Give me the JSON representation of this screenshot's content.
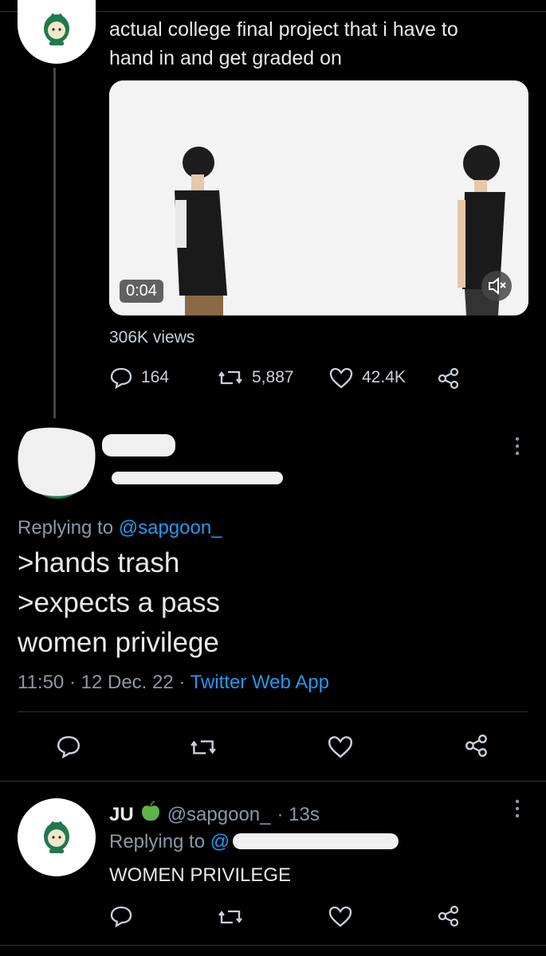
{
  "tweet1": {
    "text_line1": "actual college final project that i have to",
    "text_line2": "hand in and get graded on",
    "video_time": "0:04",
    "views": "306K views",
    "replies": "164",
    "retweets": "5,887",
    "likes": "42.4K"
  },
  "tweet2": {
    "replying_label": "Replying to ",
    "replying_handle": "@sapgoon_",
    "line1": ">hands trash",
    "line2": ">expects a pass",
    "line3": "women privilege",
    "time": "11:50",
    "date": "12 Dec. 22",
    "source": "Twitter Web App",
    "sep": "·"
  },
  "tweet3": {
    "name": "JU",
    "handle": "@sapgoon_",
    "age": "· 13s",
    "replying_label": "Replying to ",
    "replying_handle_visible": "@",
    "text": "WOMEN PRIVILEGE"
  },
  "colors": {
    "link": "#1d9bf0",
    "background": "#000000",
    "text": "#e7e9ea"
  }
}
